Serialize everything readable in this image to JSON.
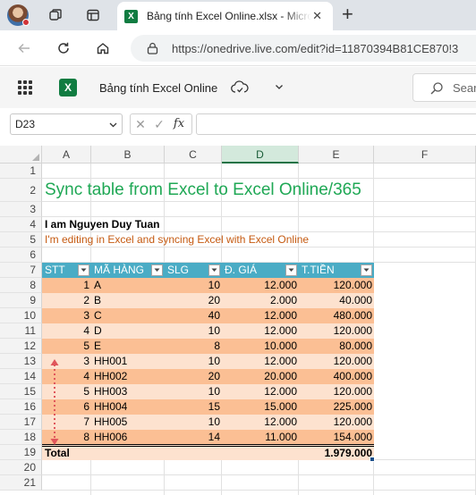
{
  "browser": {
    "tab_title": "Bảng tính Excel Online.xlsx - Micro",
    "tab_icon_letter": "X",
    "url": "https://onedrive.live.com/edit?id=11870394B81CE870!3"
  },
  "excel": {
    "doc_title": "Bảng tính Excel Online",
    "logo_letter": "X",
    "search_placeholder": "Sear",
    "name_box": "D23",
    "fx_cancel": "✕",
    "fx_enter": "✓",
    "fx_label": "fx"
  },
  "grid": {
    "columns": [
      "A",
      "B",
      "C",
      "D",
      "E",
      "F"
    ],
    "selected_column": "D",
    "rows": [
      "1",
      "2",
      "3",
      "4",
      "5",
      "6",
      "7",
      "8",
      "9",
      "10",
      "11",
      "12",
      "13",
      "14",
      "15",
      "16",
      "17",
      "18",
      "19",
      "20",
      "21"
    ]
  },
  "sheet": {
    "title": "Sync table from Excel to Excel Online/365",
    "author": "I am Nguyen Duy Tuan",
    "note": "I'm editing in Excel and syncing Excel with Excel Online",
    "table_headers": [
      "STT",
      "MÃ HÀNG",
      "SLG",
      "Đ. GIÁ",
      "T.TIỀN"
    ],
    "table_rows": [
      [
        "1",
        "A",
        "10",
        "12.000",
        "120.000"
      ],
      [
        "2",
        "B",
        "20",
        "2.000",
        "40.000"
      ],
      [
        "3",
        "C",
        "40",
        "12.000",
        "480.000"
      ],
      [
        "4",
        "D",
        "10",
        "12.000",
        "120.000"
      ],
      [
        "5",
        "E",
        "8",
        "10.000",
        "80.000"
      ],
      [
        "3",
        "HH001",
        "10",
        "12.000",
        "120.000"
      ],
      [
        "4",
        "HH002",
        "20",
        "20.000",
        "400.000"
      ],
      [
        "5",
        "HH003",
        "10",
        "12.000",
        "120.000"
      ],
      [
        "6",
        "HH004",
        "15",
        "15.000",
        "225.000"
      ],
      [
        "7",
        "HH005",
        "10",
        "12.000",
        "120.000"
      ],
      [
        "8",
        "HH006",
        "14",
        "11.000",
        "154.000"
      ]
    ],
    "total_label": "Total",
    "total_value": "1.979.000"
  },
  "colors": {
    "title_green": "#1fa855",
    "note_orange": "#c55a11",
    "table_header": "#4aacc5",
    "band_dark": "#fbbf94",
    "band_light": "#fde2cf",
    "excel_green": "#217346"
  }
}
